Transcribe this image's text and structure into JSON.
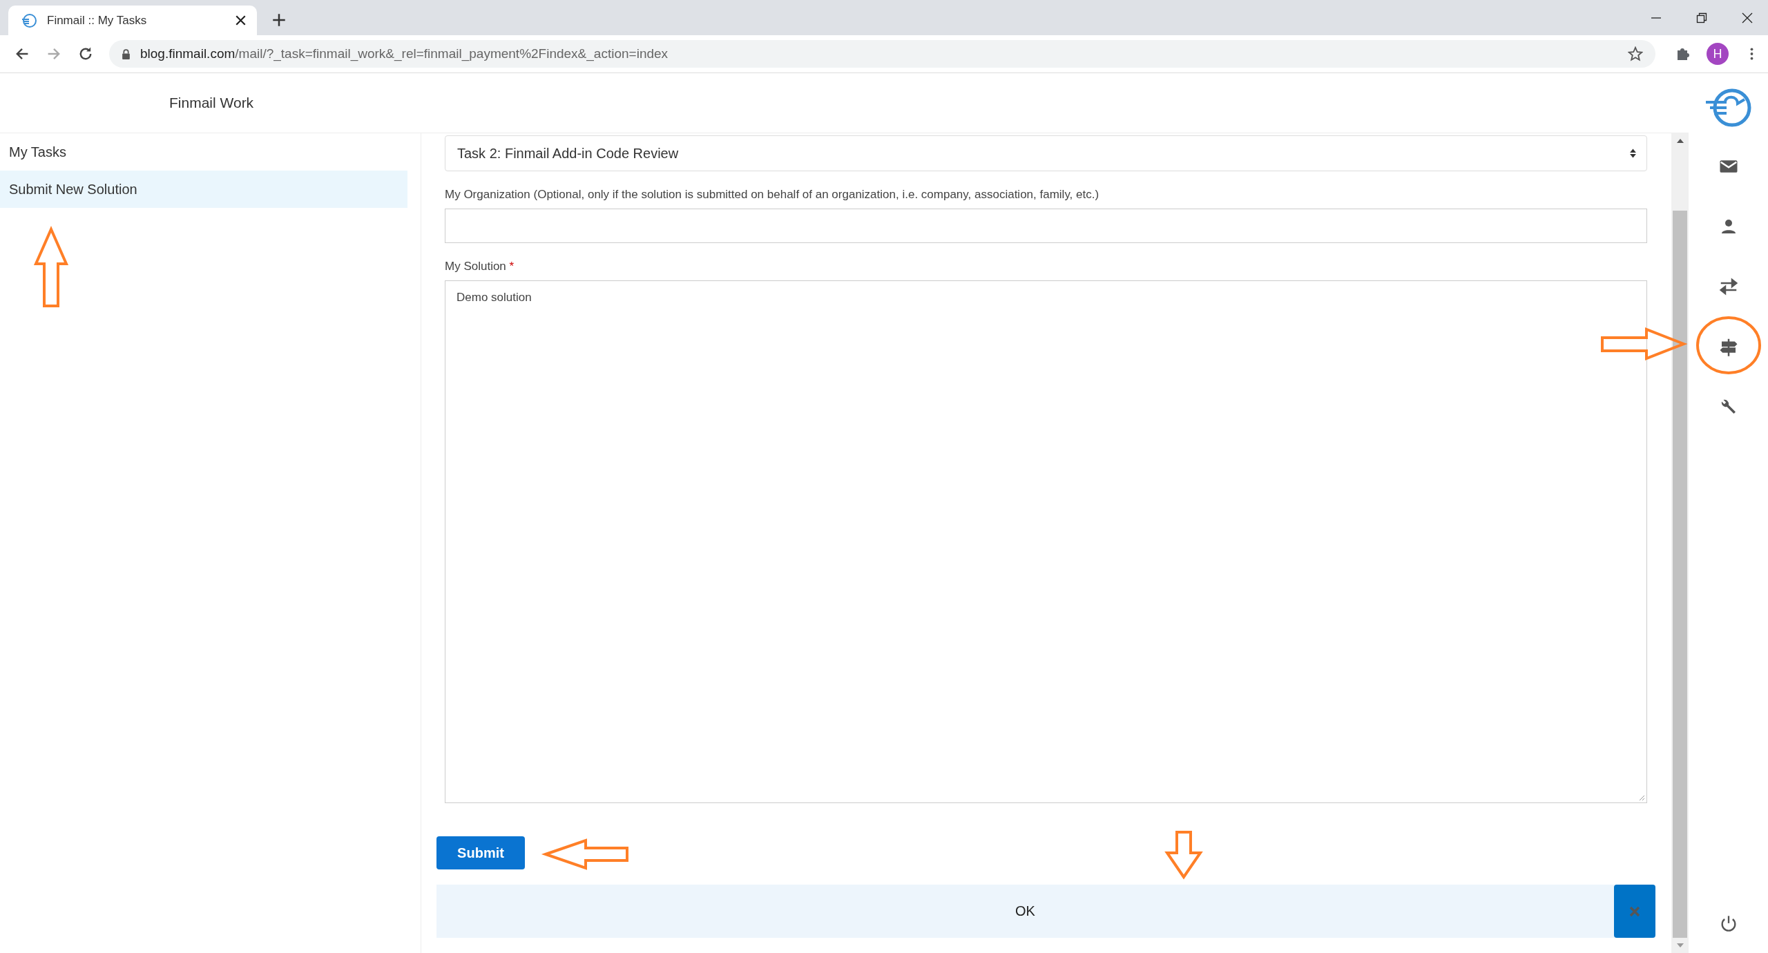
{
  "browser": {
    "tab_title": "Finmail :: My Tasks",
    "url_host": "blog.finmail.com",
    "url_path": "/mail/?_task=finmail_work&_rel=finmail_payment%2Findex&_action=index",
    "profile_initial": "H"
  },
  "app": {
    "title": "Finmail Work"
  },
  "sidebar": {
    "items": [
      {
        "label": "My Tasks",
        "selected": false
      },
      {
        "label": "Submit New Solution",
        "selected": true
      }
    ]
  },
  "form": {
    "task_select": {
      "value": "Task 2: Finmail Add-in Code Review"
    },
    "organization": {
      "label": "My Organization (Optional, only if the solution is submitted on behalf of an organization, i.e. company, association, family, etc.)"
    },
    "solution": {
      "label": "My Solution",
      "required_mark": "*",
      "value": "Demo solution"
    },
    "submit": "Submit"
  },
  "notification": {
    "message": "OK"
  }
}
